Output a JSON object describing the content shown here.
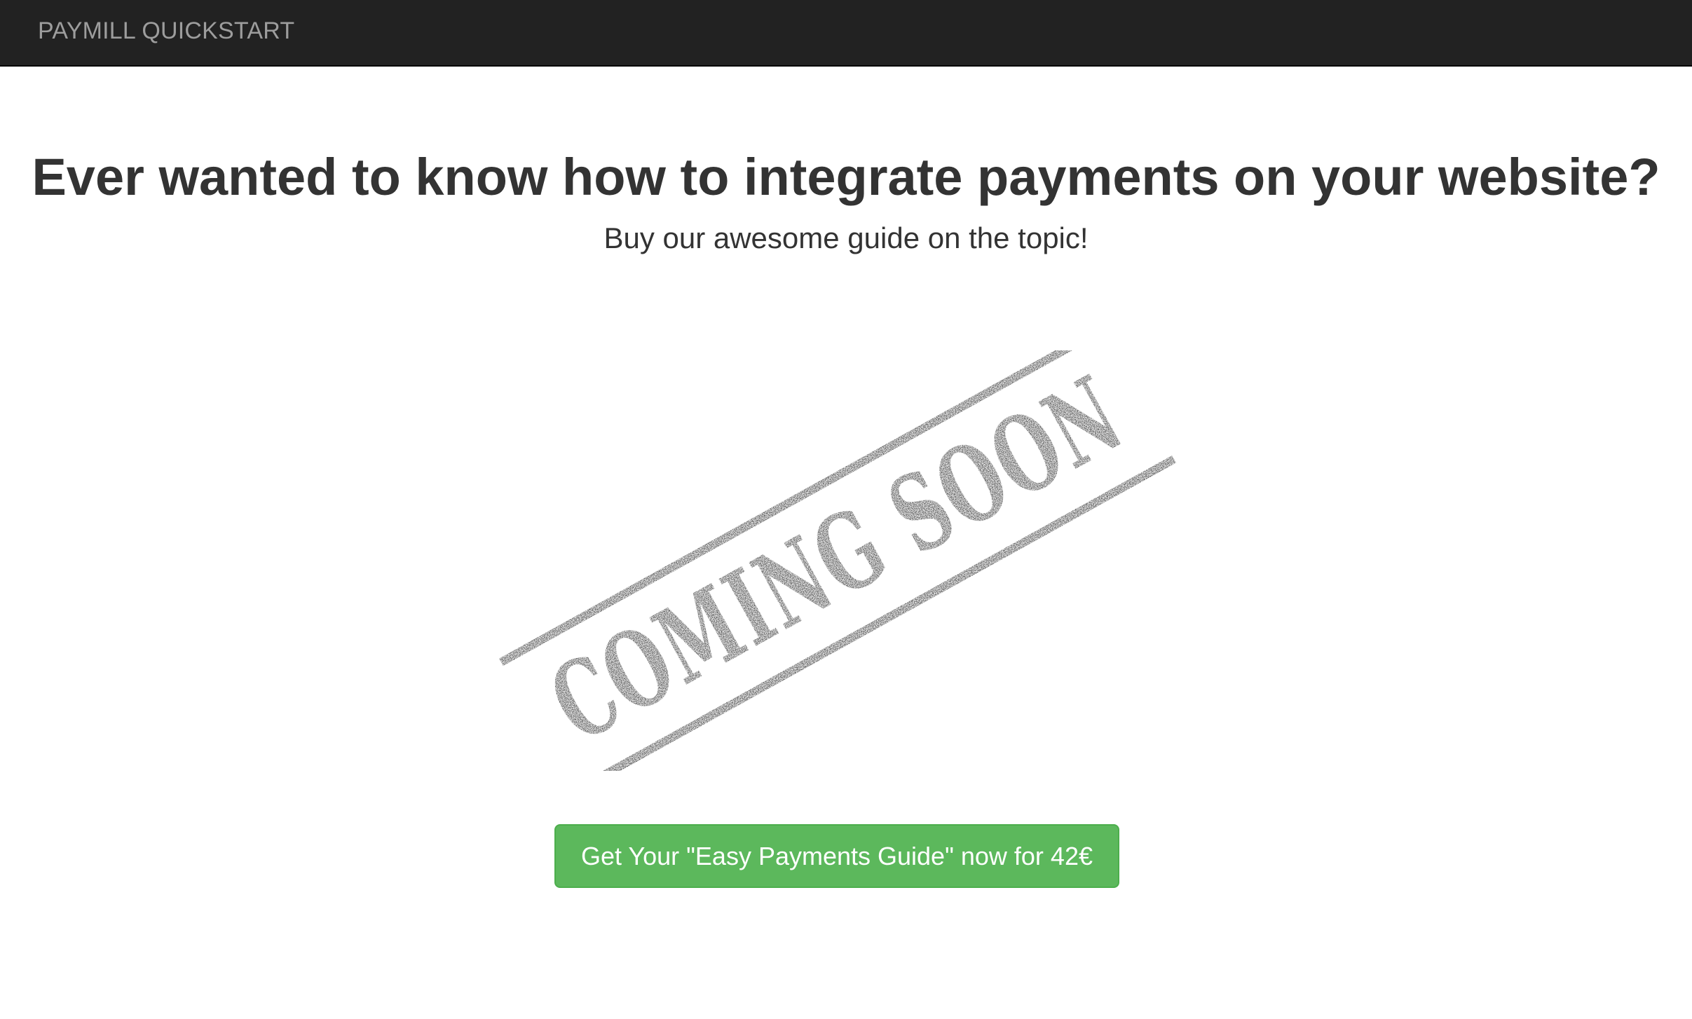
{
  "navbar": {
    "brand": "PAYMILL QUICKSTART",
    "background": "#222222",
    "brand_color": "#9d9d9d"
  },
  "hero": {
    "headline": "Ever wanted to know how to integrate payments on your website?",
    "subline": "Buy our awesome guide on the topic!"
  },
  "stamp": {
    "text": "COMING SOON",
    "color": "#1a1a1a"
  },
  "cta": {
    "label": "Get Your \"Easy Payments Guide\" now for 42€",
    "color": "#5cb85c"
  }
}
